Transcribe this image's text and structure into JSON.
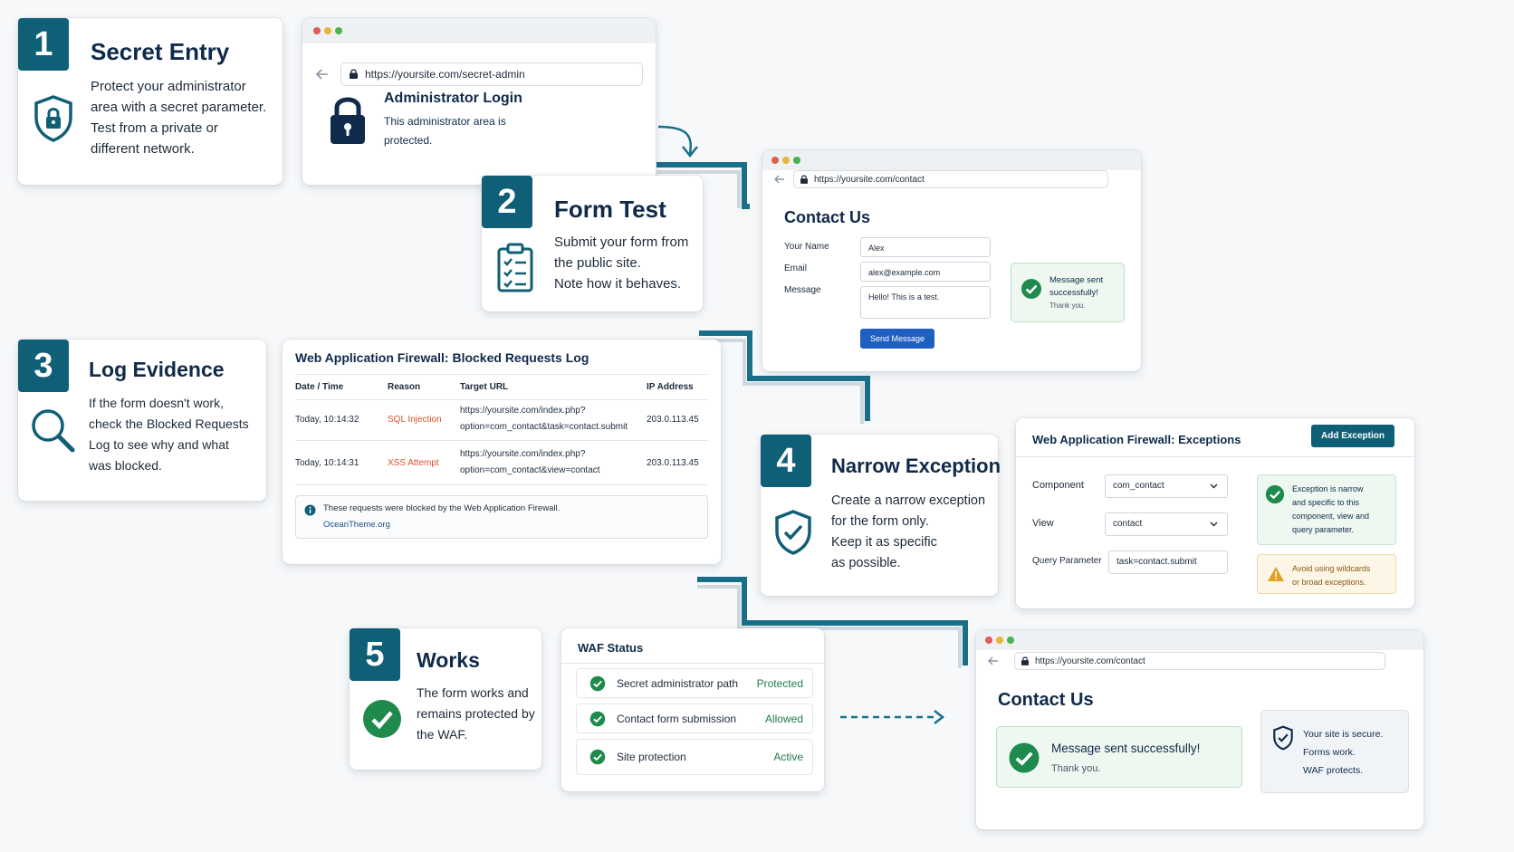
{
  "step1": {
    "number": "1",
    "title": "Secret Entry",
    "desc": [
      "Protect your administrator",
      "area with a secret parameter.",
      "Test from a private or",
      "different network."
    ],
    "browser": {
      "url": "https://yoursite.com/secret-admin",
      "heading": "Administrator Login",
      "text": [
        "This administrator area is",
        "protected."
      ]
    }
  },
  "step2": {
    "number": "2",
    "title": "Form Test",
    "desc": [
      "Submit your form from",
      "the public site.",
      "Note how it behaves."
    ],
    "browser": {
      "url": "https://yoursite.com/contact",
      "heading": "Contact Us",
      "name_label": "Your Name",
      "name_value": "Alex",
      "email_label": "Email",
      "email_value": "alex@example.com",
      "message_label": "Message",
      "message_value": "Hello! This is a test.",
      "button": "Send Message",
      "toast": [
        "Message sent",
        "successfully!",
        "Thank you."
      ]
    }
  },
  "step3": {
    "number": "3",
    "title": "Log Evidence",
    "desc": [
      "If the form doesn't work,",
      "check the Blocked Requests",
      "Log to see why and what",
      "was blocked."
    ],
    "log": {
      "title": "Web Application Firewall: Blocked Requests Log",
      "headers": [
        "Date / Time",
        "Reason",
        "Target URL",
        "IP Address"
      ],
      "rows": [
        {
          "time": "Today, 10:14:32",
          "reason": "SQL Injection",
          "url1": "https://yoursite.com/index.php?",
          "url2": "option=com_contact&task=contact.submit",
          "ip": "203.0.113.45"
        },
        {
          "time": "Today, 10:14:31",
          "reason": "XSS Attempt",
          "url1": "https://yoursite.com/index.php?",
          "url2": "option=com_contact&view=contact",
          "ip": "203.0.113.45"
        }
      ],
      "note": "These requests were blocked by the Web Application Firewall.",
      "credit": "OceanTheme.org"
    }
  },
  "step4": {
    "number": "4",
    "title": "Narrow Exception",
    "desc": [
      "Create a narrow exception",
      "for the form only.",
      "Keep it as specific",
      "as possible."
    ],
    "panel": {
      "title": "Web Application Firewall: Exceptions",
      "add_button": "Add Exception",
      "component_label": "Component",
      "component_value": "com_contact",
      "view_label": "View",
      "view_value": "contact",
      "query_label": "Query Parameter",
      "query_value": "task=contact.submit",
      "ok_note": [
        "Exception is narrow",
        "and specific to this",
        "component, view and",
        "query parameter."
      ],
      "warn_note": [
        "Avoid using wildcards",
        "or broad exceptions."
      ]
    }
  },
  "step5": {
    "number": "5",
    "title": "Works",
    "desc": [
      "The form works and",
      "remains protected by",
      "the WAF."
    ],
    "status": {
      "title": "WAF Status",
      "rows": [
        {
          "label": "Secret administrator path",
          "state": "Protected"
        },
        {
          "label": "Contact form submission",
          "state": "Allowed"
        },
        {
          "label": "Site protection",
          "state": "Active"
        }
      ]
    },
    "browser": {
      "url": "https://yoursite.com/contact",
      "heading": "Contact Us",
      "success_title": "Message sent successfully!",
      "success_sub": "Thank you.",
      "secure": [
        "Your site is secure.",
        "Forms work.",
        "WAF protects."
      ]
    }
  },
  "colors": {
    "accent": "#0f5f76",
    "navy": "#0f2a4a",
    "success": "#1e8a4c",
    "warning": "#e0a020",
    "danger": "#d9532b",
    "button": "#1f5fc2"
  }
}
